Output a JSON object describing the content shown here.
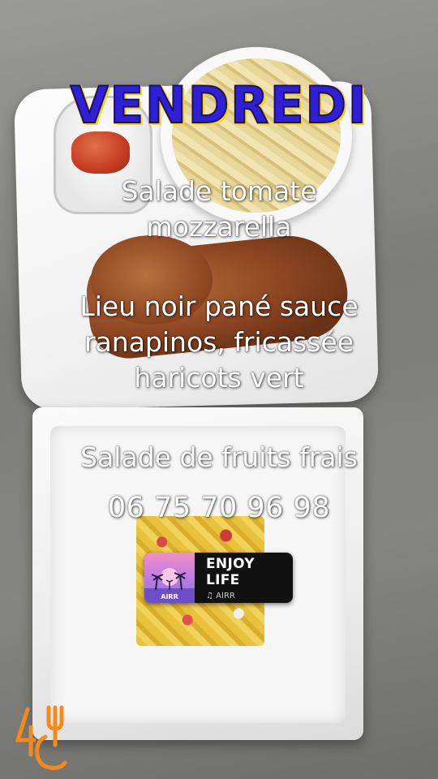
{
  "title": "VENDREDI",
  "menu": {
    "starter_line1": "Salade tomate",
    "starter_line2": "mozzarella",
    "main_line1": "Lieu noir pané sauce",
    "main_line2": "ranapinos, fricassée",
    "main_line3": "haricots vert",
    "dessert": "Salade de fruits frais",
    "phone": "06 75 70 96 98"
  },
  "music_sticker": {
    "song": "ENJOY LIFE",
    "artist": "AIRR",
    "cover_text": "AIRR",
    "note_icon": "music-note-icon"
  },
  "colors": {
    "title_fill": "#2f1fd6",
    "title_outline": "#f3d21a",
    "logo": "#f28a1e"
  }
}
